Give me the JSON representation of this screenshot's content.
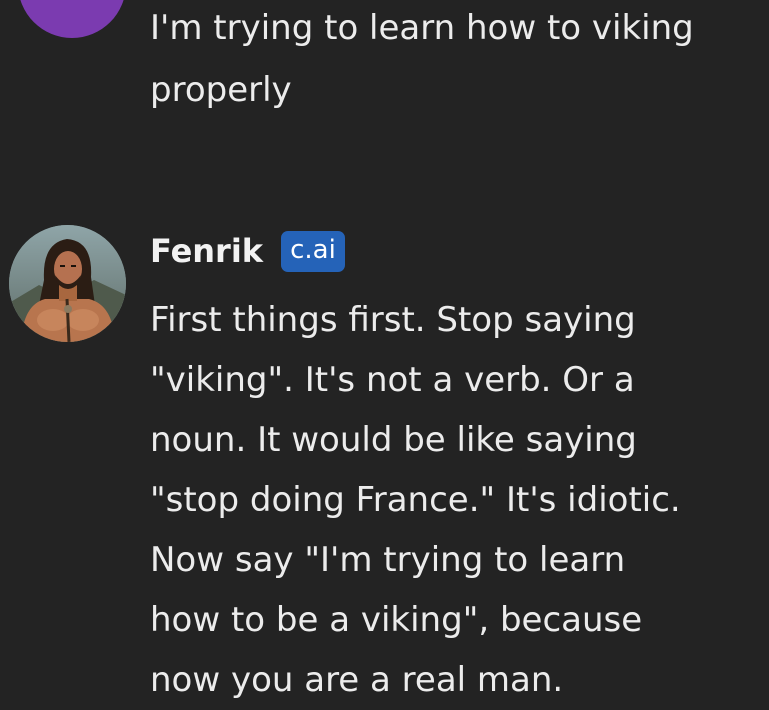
{
  "user_message": {
    "lines": [
      "I'm trying to learn how to viking",
      "properly"
    ]
  },
  "bot_message": {
    "name": "Fenrik",
    "badge": "c.ai",
    "lines": [
      "First things first. Stop saying",
      "\"viking\". It's not a verb. Or a",
      "noun. It would be like saying",
      "\"stop doing France.\" It's idiotic.",
      "Now say \"I'm trying to learn",
      "how to be a viking\", because",
      "now you are a real man."
    ]
  },
  "colors": {
    "background": "#232323",
    "user_avatar": "#7b3bb0",
    "badge": "#2563b8",
    "text": "#ececec"
  }
}
